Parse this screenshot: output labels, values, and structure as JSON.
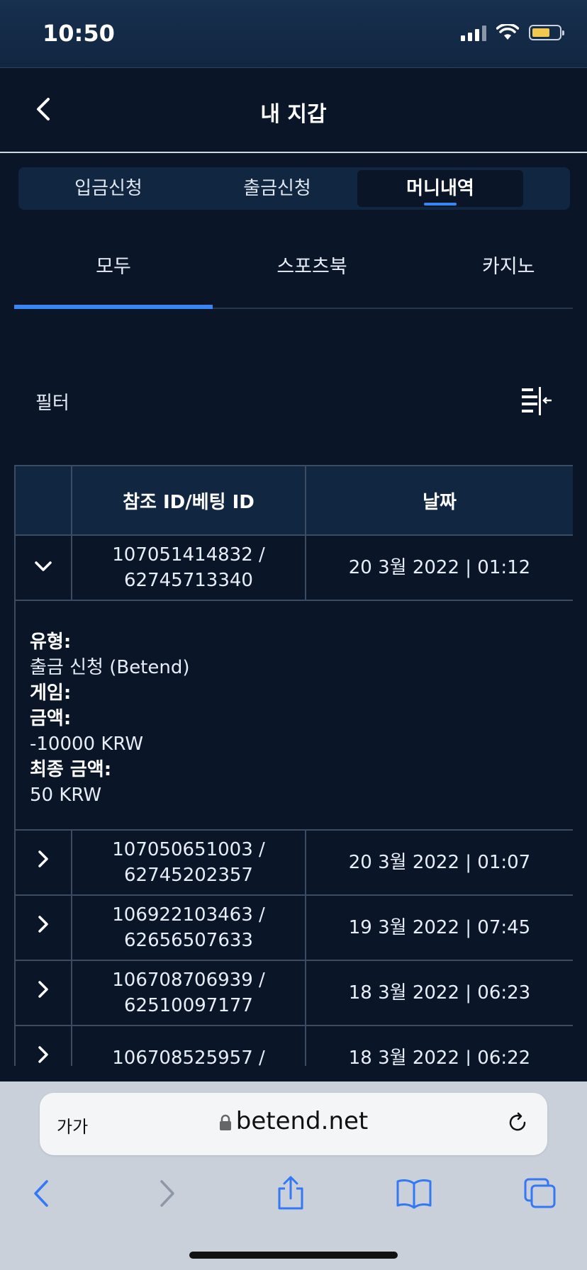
{
  "status": {
    "time": "10:50"
  },
  "header": {
    "title": "내 지갑"
  },
  "segment_tabs": [
    {
      "label": "입금신청"
    },
    {
      "label": "출금신청"
    },
    {
      "label": "머니내역"
    }
  ],
  "sub_tabs": [
    {
      "label": "모두"
    },
    {
      "label": "스포츠북"
    },
    {
      "label": "카지노"
    }
  ],
  "filter": {
    "label": "필터"
  },
  "table": {
    "headers": [
      "",
      "참조 ID/베팅 ID",
      "날짜"
    ],
    "rows": [
      {
        "ref_id": "107051414832 /",
        "bet_id": "62745713340",
        "date": "20 3월 2022 | 01:12",
        "expanded": true
      },
      {
        "ref_id": "107050651003 /",
        "bet_id": "62745202357",
        "date": "20 3월 2022 | 01:07",
        "expanded": false
      },
      {
        "ref_id": "106922103463 /",
        "bet_id": "62656507633",
        "date": "19 3월 2022 | 07:45",
        "expanded": false
      },
      {
        "ref_id": "106708706939 /",
        "bet_id": "62510097177",
        "date": "18 3월 2022 | 06:23",
        "expanded": false
      },
      {
        "ref_id": "106708525957 /",
        "bet_id": "",
        "date": "18 3월 2022 | 06:22",
        "expanded": false
      }
    ],
    "detail": {
      "type_label": "유형:",
      "type_value": "출금 신청 (Betend)",
      "game_label": "게임:",
      "amount_label": "금액:",
      "amount_value": "-10000 KRW",
      "final_label": "최종 금액:",
      "final_value": "50 KRW"
    }
  },
  "browser": {
    "text_size": "가가",
    "url": "betend.net"
  },
  "colors": {
    "accent": "#3a86f0",
    "background": "#0a1528",
    "header_bg": "#112641"
  }
}
